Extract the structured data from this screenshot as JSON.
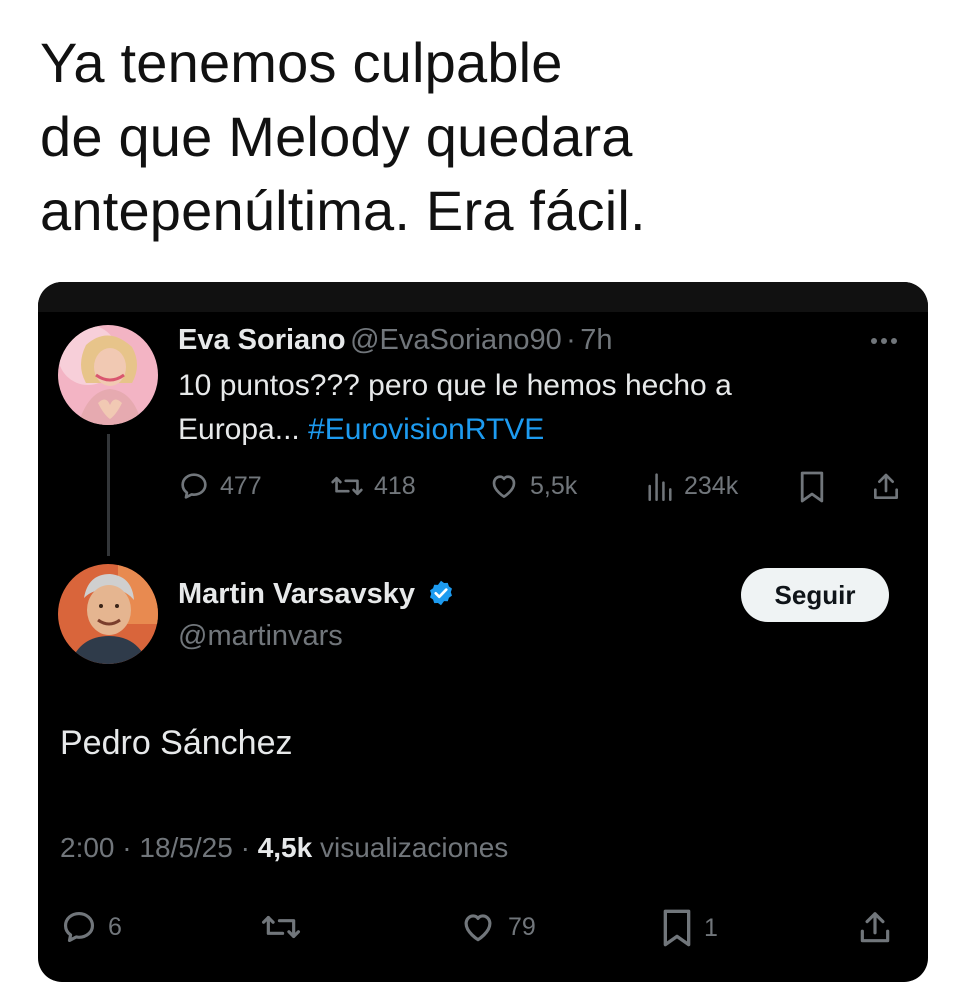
{
  "caption": {
    "line1": "Ya tenemos culpable",
    "line2": "de que Melody quedara",
    "line3": "antepenúltima. Era fácil."
  },
  "quoted_tweet": {
    "author_name": "Eva Soriano",
    "handle": "@EvaSoriano90",
    "separator": "·",
    "time": "7h",
    "text_line1": "10 puntos??? pero que le hemos hecho a",
    "text_line2_plain": "Europa... ",
    "hashtag": "#EurovisionRTVE",
    "actions": {
      "replies": "477",
      "retweets": "418",
      "likes": "5,5k",
      "views": "234k"
    }
  },
  "reply_tweet": {
    "author_name": "Martin Varsavsky",
    "handle": "@martinvars",
    "verified": true,
    "follow_label": "Seguir",
    "text": "Pedro Sánchez",
    "time": "2:00",
    "date": "18/5/25",
    "views_count": "4,5k",
    "views_label": "visualizaciones",
    "separator": "·",
    "actions": {
      "replies": "6",
      "likes": "79",
      "bookmarks": "1"
    }
  },
  "colors": {
    "card_background": "#000000",
    "primary_text": "#e7e9ea",
    "secondary_text": "#71767b",
    "link_blue": "#1d9bf0",
    "verified_blue": "#1d9bf0",
    "follow_button_bg": "#eff3f4"
  },
  "icons": [
    "reply-icon",
    "retweet-icon",
    "like-icon",
    "views-icon",
    "bookmark-icon",
    "share-icon",
    "more-icon",
    "verified-badge-icon"
  ]
}
